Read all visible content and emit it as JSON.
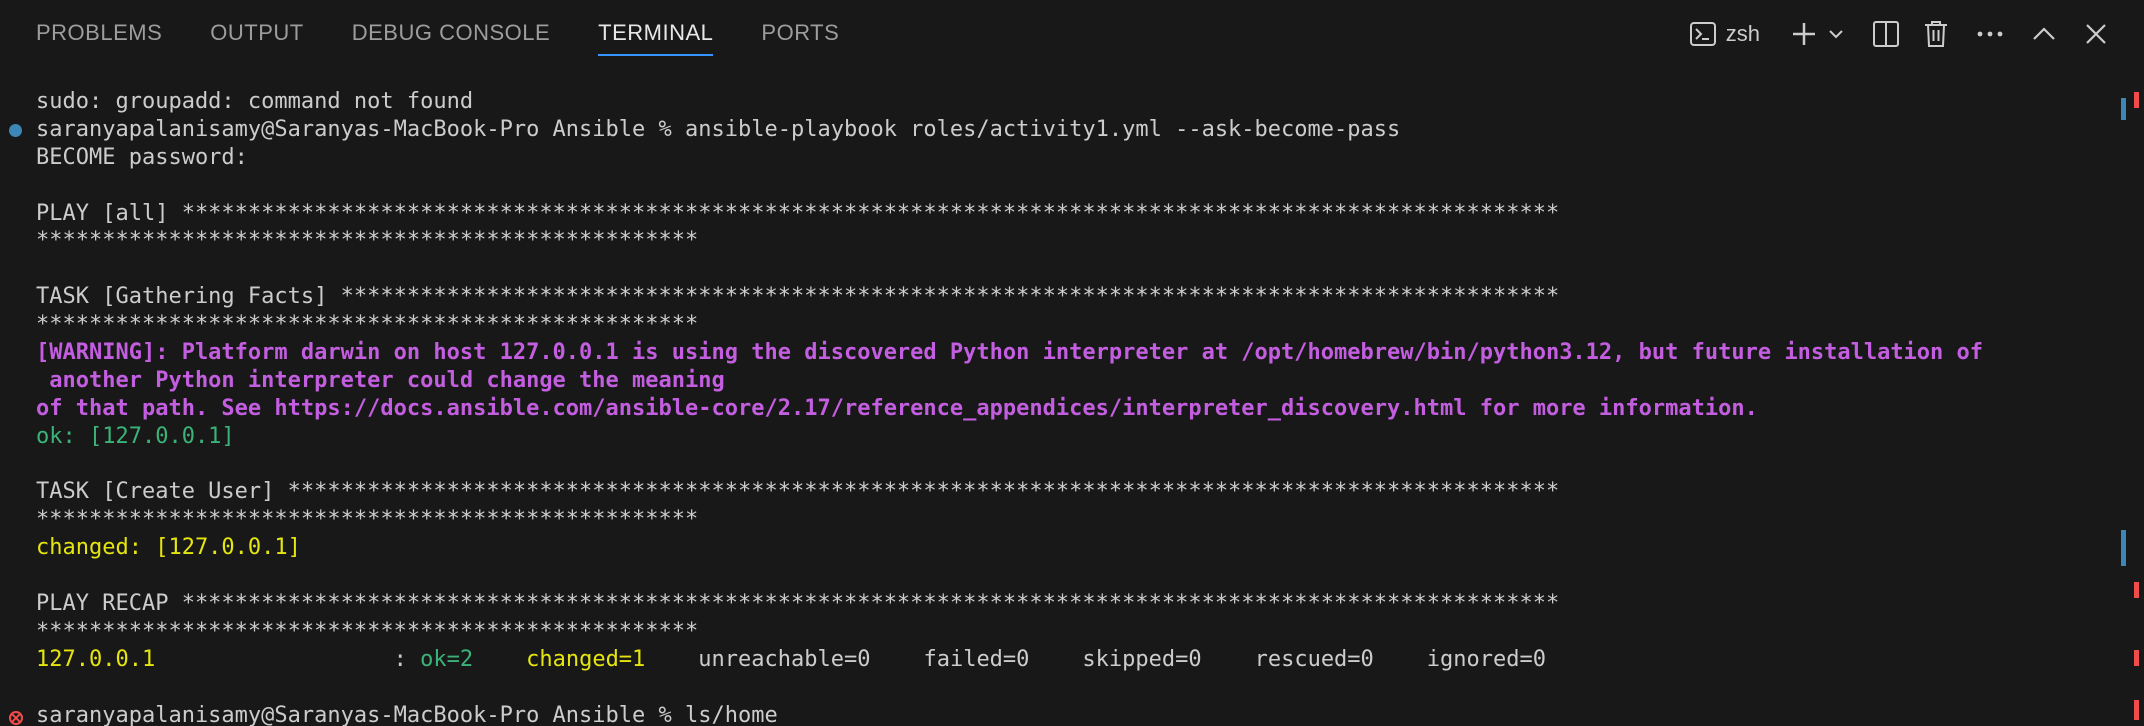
{
  "panel": {
    "tabs": [
      {
        "label": "PROBLEMS",
        "active": false
      },
      {
        "label": "OUTPUT",
        "active": false
      },
      {
        "label": "DEBUG CONSOLE",
        "active": false
      },
      {
        "label": "TERMINAL",
        "active": true
      },
      {
        "label": "PORTS",
        "active": false
      }
    ],
    "shell_name": "zsh",
    "actions": [
      "terminal-icon",
      "plus-icon",
      "chevron-down-icon",
      "split-icon",
      "trash-icon",
      "more-icon",
      "chevron-up-icon",
      "close-icon"
    ]
  },
  "terminal": {
    "lines": [
      {
        "segments": [
          {
            "text": "sudo: groupadd: command not found",
            "style": "default"
          }
        ]
      },
      {
        "decoration": "success",
        "segments": [
          {
            "text": "saranyapalanisamy@Saranyas-MacBook-Pro Ansible % ansible-playbook roles/activity1.yml --ask-become-pass",
            "style": "default"
          }
        ]
      },
      {
        "segments": [
          {
            "text": "BECOME password:",
            "style": "default"
          }
        ]
      },
      {
        "segments": [
          {
            "text": "",
            "style": "default"
          }
        ]
      },
      {
        "segments": [
          {
            "text": "PLAY [all] ********************************************************************************************************",
            "style": "default"
          }
        ]
      },
      {
        "segments": [
          {
            "text": "**************************************************",
            "style": "default"
          }
        ]
      },
      {
        "segments": [
          {
            "text": "",
            "style": "default"
          }
        ]
      },
      {
        "segments": [
          {
            "text": "TASK [Gathering Facts] ********************************************************************************************",
            "style": "default"
          }
        ]
      },
      {
        "segments": [
          {
            "text": "**************************************************",
            "style": "default"
          }
        ]
      },
      {
        "segments": [
          {
            "text": "[WARNING]: Platform darwin on host 127.0.0.1 is using the discovered Python interpreter at /opt/homebrew/bin/python3.12, but future installation of",
            "style": "warn"
          }
        ]
      },
      {
        "segments": [
          {
            "text": " another Python interpreter could change the meaning",
            "style": "warn"
          }
        ]
      },
      {
        "segments": [
          {
            "text": "of that path. See https://docs.ansible.com/ansible-core/2.17/reference_appendices/interpreter_discovery.html for more information.",
            "style": "warn"
          }
        ]
      },
      {
        "segments": [
          {
            "text": "ok: [127.0.0.1]",
            "style": "ok"
          }
        ]
      },
      {
        "segments": [
          {
            "text": "",
            "style": "default"
          }
        ]
      },
      {
        "segments": [
          {
            "text": "TASK [Create User] ************************************************************************************************",
            "style": "default"
          }
        ]
      },
      {
        "segments": [
          {
            "text": "**************************************************",
            "style": "default"
          }
        ]
      },
      {
        "segments": [
          {
            "text": "changed: [127.0.0.1]",
            "style": "changed"
          }
        ]
      },
      {
        "segments": [
          {
            "text": "",
            "style": "default"
          }
        ]
      },
      {
        "segments": [
          {
            "text": "PLAY RECAP ********************************************************************************************************",
            "style": "default"
          }
        ]
      },
      {
        "segments": [
          {
            "text": "**************************************************",
            "style": "default"
          }
        ]
      },
      {
        "segments": [
          {
            "text": "127.0.0.1",
            "style": "host"
          },
          {
            "text": "                  : ",
            "style": "default"
          },
          {
            "text": "ok=2",
            "style": "ok"
          },
          {
            "text": "    ",
            "style": "default"
          },
          {
            "text": "changed=1",
            "style": "changed"
          },
          {
            "text": "    unreachable=0    failed=0    skipped=0    rescued=0    ignored=0",
            "style": "default"
          }
        ]
      },
      {
        "segments": [
          {
            "text": "",
            "style": "default"
          }
        ]
      },
      {
        "decoration": "error",
        "segments": [
          {
            "text": "saranyapalanisamy@Saranyas-MacBook-Pro Ansible % ls/home",
            "style": "default"
          }
        ]
      }
    ]
  },
  "colors": {
    "background": "#181818",
    "tab_active_underline": "#3794ff",
    "warning": "#c35ee0",
    "ok": "#3bb378",
    "changed": "#e5e510",
    "success_decoration": "#3c87b8",
    "error_decoration": "#f14c4c"
  }
}
